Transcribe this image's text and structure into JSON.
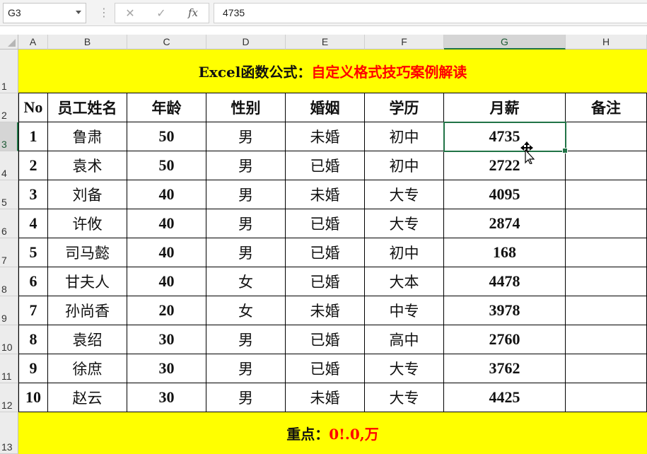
{
  "formula_bar": {
    "name_box": "G3",
    "dots": "⋮",
    "cancel_glyph": "✕",
    "enter_glyph": "✓",
    "fx_label": "fx",
    "value": "4735"
  },
  "columns": [
    "A",
    "B",
    "C",
    "D",
    "E",
    "F",
    "G",
    "H"
  ],
  "rows": [
    "1",
    "2",
    "3",
    "4",
    "5",
    "6",
    "7",
    "8",
    "9",
    "10",
    "11",
    "12",
    "13"
  ],
  "banner_title": {
    "black": "Excel函数公式：",
    "red": "自定义格式技巧案例解读"
  },
  "table": {
    "headers": [
      "No",
      "员工姓名",
      "年龄",
      "性别",
      "婚姻",
      "学历",
      "月薪",
      "备注"
    ],
    "rows": [
      [
        "1",
        "鲁肃",
        "50",
        "男",
        "未婚",
        "初中",
        "4735",
        ""
      ],
      [
        "2",
        "袁术",
        "50",
        "男",
        "已婚",
        "初中",
        "2722",
        ""
      ],
      [
        "3",
        "刘备",
        "40",
        "男",
        "未婚",
        "大专",
        "4095",
        ""
      ],
      [
        "4",
        "许攸",
        "40",
        "男",
        "已婚",
        "大专",
        "2874",
        ""
      ],
      [
        "5",
        "司马懿",
        "40",
        "男",
        "已婚",
        "初中",
        "168",
        ""
      ],
      [
        "6",
        "甘夫人",
        "40",
        "女",
        "已婚",
        "大本",
        "4478",
        ""
      ],
      [
        "7",
        "孙尚香",
        "20",
        "女",
        "未婚",
        "中专",
        "3978",
        ""
      ],
      [
        "8",
        "袁绍",
        "30",
        "男",
        "已婚",
        "高中",
        "2760",
        ""
      ],
      [
        "9",
        "徐庶",
        "30",
        "男",
        "已婚",
        "大专",
        "3762",
        ""
      ],
      [
        "10",
        "赵云",
        "30",
        "男",
        "未婚",
        "大专",
        "4425",
        ""
      ]
    ]
  },
  "footer_note": {
    "black": "重点：",
    "red": "0!.0,万"
  },
  "selected_cell": "G3",
  "colors": {
    "banner": "#ffff00",
    "accent_red": "#ff0000",
    "selection": "#217346"
  }
}
